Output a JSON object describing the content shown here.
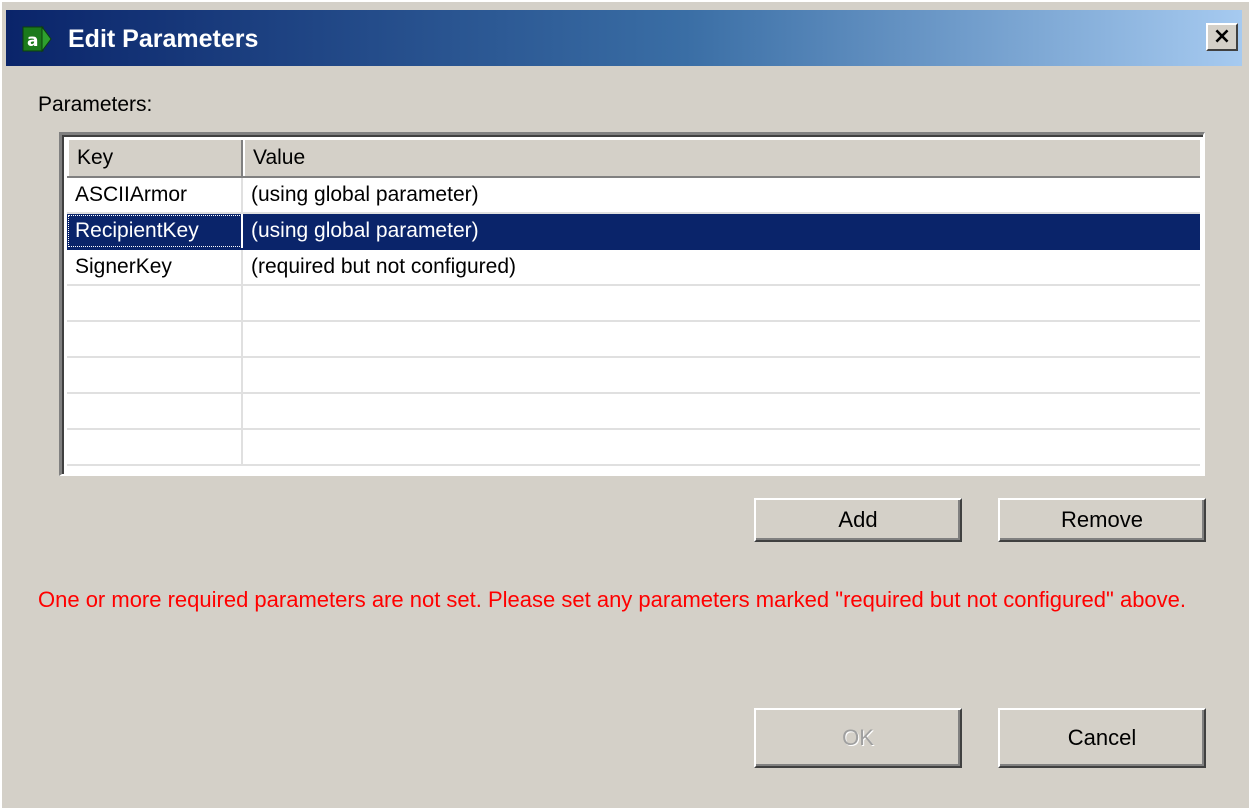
{
  "window": {
    "title": "Edit Parameters",
    "close_glyph": "×",
    "app_icon": "green-arrow-a-icon"
  },
  "parameters_label": "Parameters:",
  "table": {
    "columns": [
      "Key",
      "Value"
    ],
    "rows": [
      {
        "key": "ASCIIArmor",
        "value": "(using global parameter)",
        "selected": false
      },
      {
        "key": "RecipientKey",
        "value": "(using global parameter)",
        "selected": true
      },
      {
        "key": "SignerKey",
        "value": "(required but not configured)",
        "selected": false
      },
      {
        "key": "",
        "value": "",
        "selected": false
      },
      {
        "key": "",
        "value": "",
        "selected": false
      },
      {
        "key": "",
        "value": "",
        "selected": false
      },
      {
        "key": "",
        "value": "",
        "selected": false
      },
      {
        "key": "",
        "value": "",
        "selected": false
      }
    ]
  },
  "buttons": {
    "add": "Add",
    "remove": "Remove",
    "ok": "OK",
    "ok_enabled": false,
    "cancel": "Cancel"
  },
  "error_message": "One or more required parameters are not set. Please set any parameters marked \"required but not configured\" above.",
  "colors": {
    "title_bar_start": "#0a246a",
    "title_bar_end": "#a6caf0",
    "selection": "#0a246a",
    "error_text": "#ff0000",
    "face": "#d4d0c8"
  }
}
